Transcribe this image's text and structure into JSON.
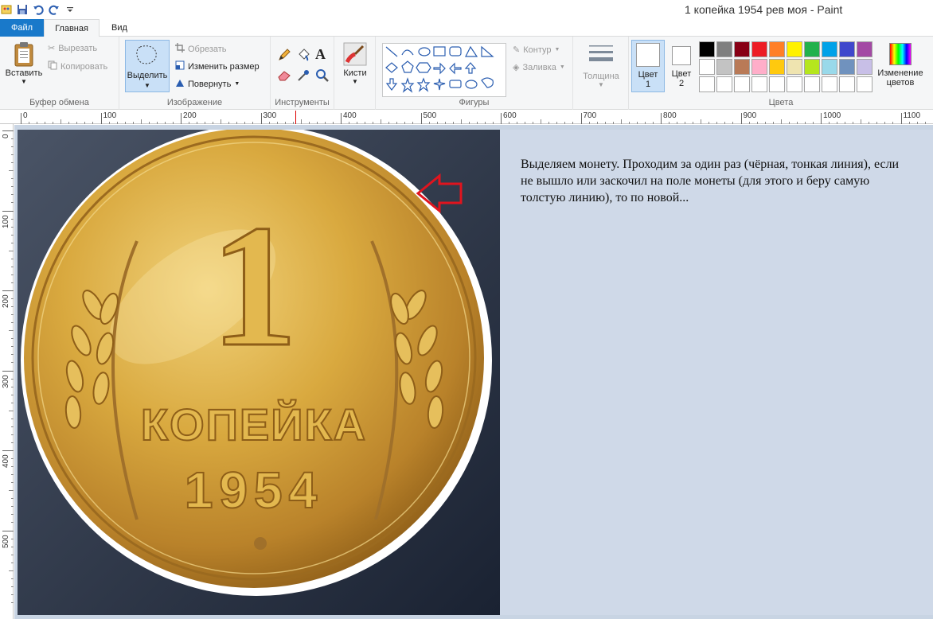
{
  "window": {
    "title": "1 копейка 1954 рев моя - Paint"
  },
  "tabs": {
    "file": "Файл",
    "home": "Главная",
    "view": "Вид"
  },
  "clipboard": {
    "paste": "Вставить",
    "cut": "Вырезать",
    "copy": "Копировать",
    "label": "Буфер обмена"
  },
  "image": {
    "select": "Выделить",
    "crop": "Обрезать",
    "resize": "Изменить размер",
    "rotate": "Повернуть",
    "label": "Изображение"
  },
  "tools": {
    "label": "Инструменты"
  },
  "brushes": {
    "label": "Кисти"
  },
  "shapes": {
    "outline": "Контур",
    "fill": "Заливка",
    "label": "Фигуры"
  },
  "size": {
    "label": "Толщина"
  },
  "colors": {
    "color1_line1": "Цвет",
    "color1_line2": "1",
    "color2_line1": "Цвет",
    "color2_line2": "2",
    "edit_line1": "Изменение",
    "edit_line2": "цветов",
    "label": "Цвета",
    "palette": [
      "#000000",
      "#7f7f7f",
      "#880015",
      "#ed1c24",
      "#ff7f27",
      "#fff200",
      "#22b14c",
      "#00a2e8",
      "#3f48cc",
      "#a349a4",
      "#ffffff",
      "#c3c3c3",
      "#b97a57",
      "#ffaec9",
      "#ffc90e",
      "#efe4b0",
      "#b5e61d",
      "#99d9ea",
      "#7092be",
      "#c8bfe7",
      "#ffffff",
      "#ffffff",
      "#ffffff",
      "#ffffff",
      "#ffffff",
      "#ffffff",
      "#ffffff",
      "#ffffff",
      "#ffffff",
      "#ffffff"
    ]
  },
  "ruler": {
    "h": [
      "0",
      "100",
      "200",
      "300",
      "400",
      "500",
      "600",
      "700",
      "800",
      "900",
      "1000",
      "1100"
    ],
    "v": [
      "0",
      "100",
      "200",
      "300",
      "400",
      "500"
    ]
  },
  "coin": {
    "denomination": "1",
    "word": "КОПЕЙКА",
    "year": "1954"
  },
  "note": "Выделяем монету. Проходим за один раз (чёрная, тонкая линия), если не вышло или заскочил на поле монеты (для этого и беру самую толстую линию), то по новой..."
}
